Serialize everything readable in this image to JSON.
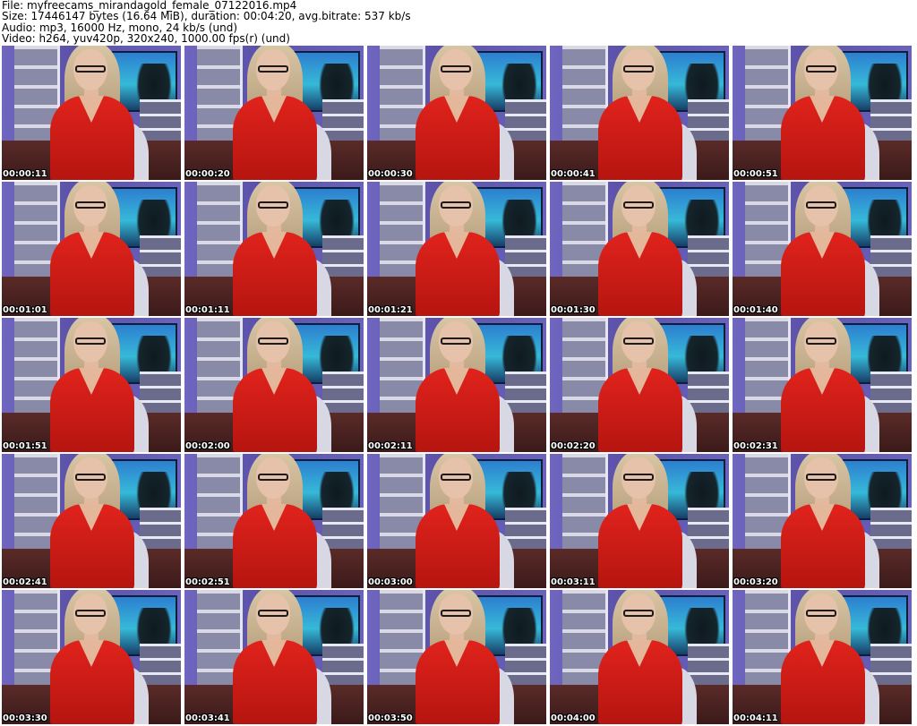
{
  "header": {
    "file_line": "File: myfreecams_mirandagold_female_07122016.mp4",
    "size_line": "Size: 17446147 bytes (16.64 MiB), duration: 00:04:20, avg.bitrate: 537 kb/s",
    "audio_line": "Audio: mp3, 16000 Hz, mono, 24 kb/s (und)",
    "video_line": "Video: h264, yuv420p, 320x240, 1000.00 fps(r) (und)"
  },
  "thumbnails": [
    {
      "timestamp": "00:00:11"
    },
    {
      "timestamp": "00:00:20"
    },
    {
      "timestamp": "00:00:30"
    },
    {
      "timestamp": "00:00:41"
    },
    {
      "timestamp": "00:00:51"
    },
    {
      "timestamp": "00:01:01"
    },
    {
      "timestamp": "00:01:11"
    },
    {
      "timestamp": "00:01:21"
    },
    {
      "timestamp": "00:01:30"
    },
    {
      "timestamp": "00:01:40"
    },
    {
      "timestamp": "00:01:51"
    },
    {
      "timestamp": "00:02:00"
    },
    {
      "timestamp": "00:02:11"
    },
    {
      "timestamp": "00:02:20"
    },
    {
      "timestamp": "00:02:31"
    },
    {
      "timestamp": "00:02:41"
    },
    {
      "timestamp": "00:02:51"
    },
    {
      "timestamp": "00:03:00"
    },
    {
      "timestamp": "00:03:11"
    },
    {
      "timestamp": "00:03:20"
    },
    {
      "timestamp": "00:03:30"
    },
    {
      "timestamp": "00:03:41"
    },
    {
      "timestamp": "00:03:50"
    },
    {
      "timestamp": "00:04:00"
    },
    {
      "timestamp": "00:04:11"
    }
  ]
}
